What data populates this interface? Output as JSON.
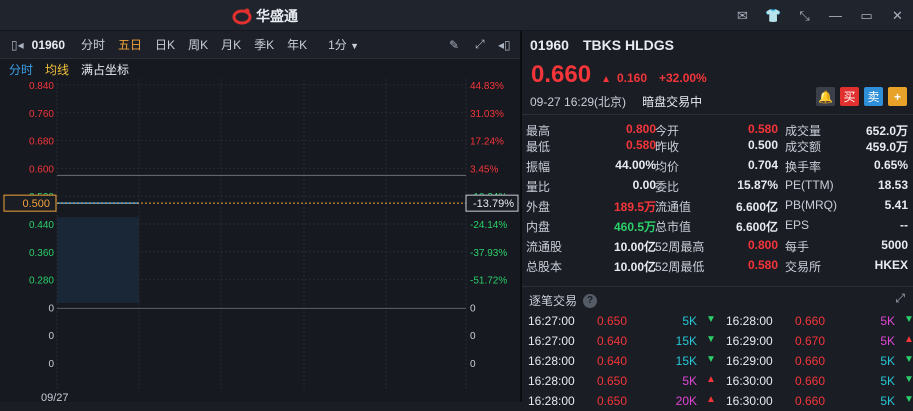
{
  "app": {
    "title": "华盛通"
  },
  "toolbar": {
    "code": "01960",
    "tabs": [
      "分时",
      "五日",
      "日K",
      "周K",
      "月K",
      "季K",
      "年K"
    ],
    "active_tab": "五日",
    "interval": "1分"
  },
  "subbar": {
    "items": [
      "分时",
      "均线",
      "满占坐标"
    ]
  },
  "chart": {
    "left_ticks": [
      "0.840",
      "0.760",
      "0.680",
      "0.600",
      "0.520",
      "0.440",
      "0.360",
      "0.280",
      "0",
      "0",
      "0"
    ],
    "right_ticks": [
      "44.83%",
      "31.03%",
      "17.24%",
      "3.45%",
      "-10.34%",
      "-24.14%",
      "-37.93%",
      "-51.72%",
      "0",
      "0",
      "0"
    ],
    "current_left": "0.500",
    "current_right": "-13.79%",
    "date": "09/27",
    "price_line": 0.5,
    "prev_close": 0.58
  },
  "quote": {
    "code": "01960",
    "name": "TBKS HLDGS",
    "price": "0.660",
    "change": "0.160",
    "change_pct": "+32.00%",
    "time": "09-27 16:29(北京)",
    "status": "暗盘交易中",
    "buttons": {
      "buy": "买",
      "sell": "卖",
      "plus": "+"
    }
  },
  "stats": [
    [
      [
        "最高",
        "0.800",
        "red"
      ],
      [
        "今开",
        "0.580",
        "red"
      ],
      [
        "成交量",
        "652.0万",
        "white"
      ]
    ],
    [
      [
        "最低",
        "0.580",
        "red"
      ],
      [
        "昨收",
        "0.500",
        "white"
      ],
      [
        "成交额",
        "459.0万",
        "white"
      ]
    ],
    [
      [
        "振幅",
        "44.00%",
        "white"
      ],
      [
        "均价",
        "0.704",
        "white"
      ],
      [
        "换手率",
        "0.65%",
        "white"
      ]
    ],
    [
      [
        "量比",
        "0.00",
        "white"
      ],
      [
        "委比",
        "15.87%",
        "white"
      ],
      [
        "PE(TTM)",
        "18.53",
        "white"
      ]
    ],
    [
      [
        "外盘",
        "189.5万",
        "red"
      ],
      [
        "流通值",
        "6.600亿",
        "white"
      ],
      [
        "PB(MRQ)",
        "5.41",
        "white"
      ]
    ],
    [
      [
        "内盘",
        "460.5万",
        "green"
      ],
      [
        "总市值",
        "6.600亿",
        "white"
      ],
      [
        "EPS",
        "--",
        "white"
      ]
    ],
    [
      [
        "流通股",
        "10.00亿",
        "white"
      ],
      [
        "52周最高",
        "0.800",
        "red"
      ],
      [
        "每手",
        "5000",
        "white"
      ]
    ],
    [
      [
        "总股本",
        "10.00亿",
        "white"
      ],
      [
        "52周最低",
        "0.580",
        "red"
      ],
      [
        "交易所",
        "HKEX",
        "white"
      ]
    ]
  ],
  "ticks": {
    "title": "逐笔交易",
    "rows": [
      [
        [
          "16:27:00",
          "0.650",
          "5K",
          "cyan",
          "green"
        ],
        [
          "16:28:00",
          "0.660",
          "5K",
          "magenta",
          "green"
        ]
      ],
      [
        [
          "16:27:00",
          "0.640",
          "15K",
          "cyan",
          "green"
        ],
        [
          "16:29:00",
          "0.670",
          "5K",
          "magenta",
          "red"
        ]
      ],
      [
        [
          "16:28:00",
          "0.640",
          "15K",
          "cyan",
          "green"
        ],
        [
          "16:29:00",
          "0.660",
          "5K",
          "cyan",
          "green"
        ]
      ],
      [
        [
          "16:28:00",
          "0.650",
          "5K",
          "magenta",
          "red"
        ],
        [
          "16:30:00",
          "0.660",
          "5K",
          "cyan",
          "green"
        ]
      ],
      [
        [
          "16:28:00",
          "0.650",
          "20K",
          "magenta",
          "red"
        ],
        [
          "16:30:00",
          "0.660",
          "5K",
          "cyan",
          "green"
        ]
      ]
    ]
  }
}
